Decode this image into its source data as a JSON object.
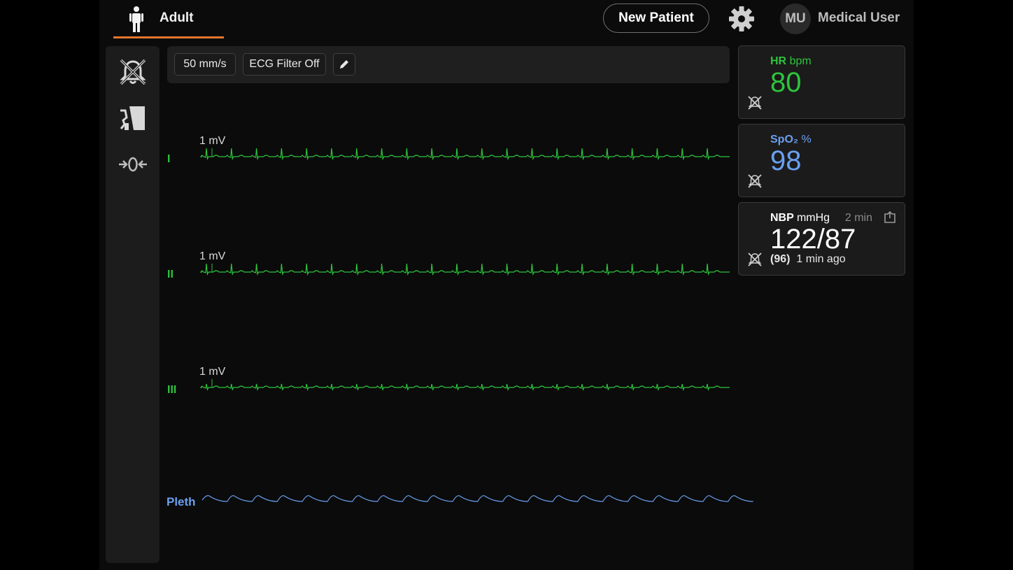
{
  "header": {
    "patient_type": "Adult",
    "new_patient_label": "New Patient",
    "user_initials": "MU",
    "user_name": "Medical User"
  },
  "sidebar": {
    "items": [
      {
        "icon": "alarm-silence-icon"
      },
      {
        "icon": "printer-icon"
      },
      {
        "icon": "zero-calibrate-icon"
      }
    ]
  },
  "toolbar": {
    "sweep_speed": "50 mm/s",
    "ecg_filter": "ECG Filter Off",
    "edit_icon": "pencil-icon"
  },
  "waves": {
    "leads": [
      {
        "label": "I",
        "scale": "1 mV"
      },
      {
        "label": "II",
        "scale": "1 mV"
      },
      {
        "label": "III",
        "scale": "1 mV"
      }
    ],
    "pleth_label": "Pleth"
  },
  "params": {
    "hr": {
      "name": "HR",
      "unit": "bpm",
      "value": "80",
      "color": "#2ec43d"
    },
    "spo2": {
      "name": "SpO₂",
      "unit": "%",
      "value": "98",
      "color": "#6aa0f0"
    },
    "nbp": {
      "name": "NBP",
      "unit": "mmHg",
      "interval": "2 min",
      "value": "122/87",
      "mean": "(96)",
      "age": "1 min ago",
      "color": "#ffffff"
    }
  },
  "colors": {
    "ecg": "#2ec43d",
    "pleth": "#6aa0f0",
    "accent": "#e5772e"
  }
}
